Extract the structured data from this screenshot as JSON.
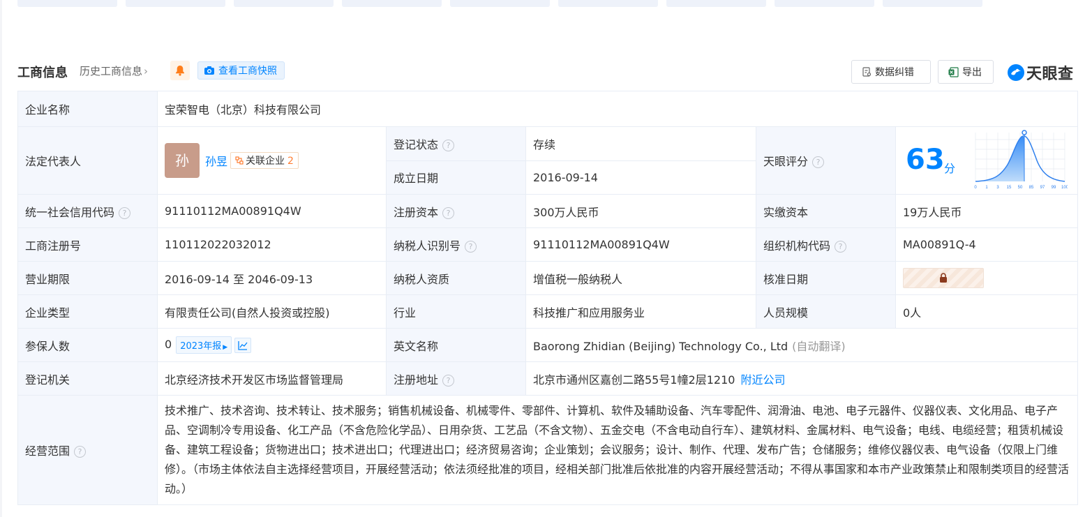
{
  "header": {
    "title": "工商信息",
    "history_link": "历史工商信息",
    "snapshot_button": "查看工商快照",
    "correct_button": "数据纠错",
    "export_button": "导出",
    "brand": "天眼查"
  },
  "company": {
    "name_label": "企业名称",
    "name": "宝荣智电（北京）科技有限公司",
    "legal_rep_label": "法定代表人",
    "legal_rep_avatar": "孙",
    "legal_rep_name": "孙昱",
    "related_label": "关联企业",
    "related_count": "2",
    "status_label": "登记状态",
    "status": "存续",
    "founded_label": "成立日期",
    "founded": "2016-09-14",
    "score_label": "天眼评分",
    "score": "63",
    "score_unit": "分",
    "score_axis_ticks": [
      "0",
      "1",
      "3",
      "15",
      "50",
      "85",
      "97",
      "99",
      "100"
    ],
    "credit_code_label": "统一社会信用代码",
    "credit_code": "91110112MA00891Q4W",
    "reg_capital_label": "注册资本",
    "reg_capital": "300万人民币",
    "paid_capital_label": "实缴资本",
    "paid_capital": "19万人民币",
    "reg_no_label": "工商注册号",
    "reg_no": "110112022032012",
    "taxpayer_id_label": "纳税人识别号",
    "taxpayer_id": "91110112MA00891Q4W",
    "org_code_label": "组织机构代码",
    "org_code": "MA00891Q-4",
    "term_label": "营业期限",
    "term": "2016-09-14 至 2046-09-13",
    "tax_qual_label": "纳税人资质",
    "tax_qual": "增值税一般纳税人",
    "approve_date_label": "核准日期",
    "type_label": "企业类型",
    "type": "有限责任公司(自然人投资或控股)",
    "industry_label": "行业",
    "industry": "科技推广和应用服务业",
    "staff_label": "人员规模",
    "staff": "0人",
    "insured_label": "参保人数",
    "insured": "0",
    "insured_year": "2023年报",
    "english_label": "英文名称",
    "english": "Baorong Zhidian (Beijing) Technology Co., Ltd",
    "auto_translate": "(自动翻译)",
    "authority_label": "登记机关",
    "authority": "北京经济技术开发区市场监督管理局",
    "address_label": "注册地址",
    "address": "北京市通州区嘉创二路55号1幢2层1210",
    "nearby_link": "附近公司",
    "scope_label": "经营范围",
    "scope": "技术推广、技术咨询、技术转让、技术服务；销售机械设备、机械零件、零部件、计算机、软件及辅助设备、汽车零配件、润滑油、电池、电子元器件、仪器仪表、文化用品、电子产品、空调制冷专用设备、化工产品（不含危险化学品）、日用杂货、工艺品（不含文物）、五金交电（不含电动自行车）、建筑材料、金属材料、电气设备；电线、电缆经营；租赁机械设备、建筑工程设备；货物进出口；技术进出口；代理进出口；经济贸易咨询；企业策划；会议服务；设计、制作、代理、发布广告；仓储服务；维修仪器仪表、电气设备（仅限上门维修）。（市场主体依法自主选择经营项目，开展经营活动；依法须经批准的项目，经相关部门批准后依批准的内容开展经营活动；不得从事国家和本市产业政策禁止和限制类项目的经营活动。）"
  },
  "colors": {
    "accent": "#0084ff",
    "status_green": "#00a870",
    "label_bg": "#f4f7fd",
    "border": "#e8edf5"
  }
}
